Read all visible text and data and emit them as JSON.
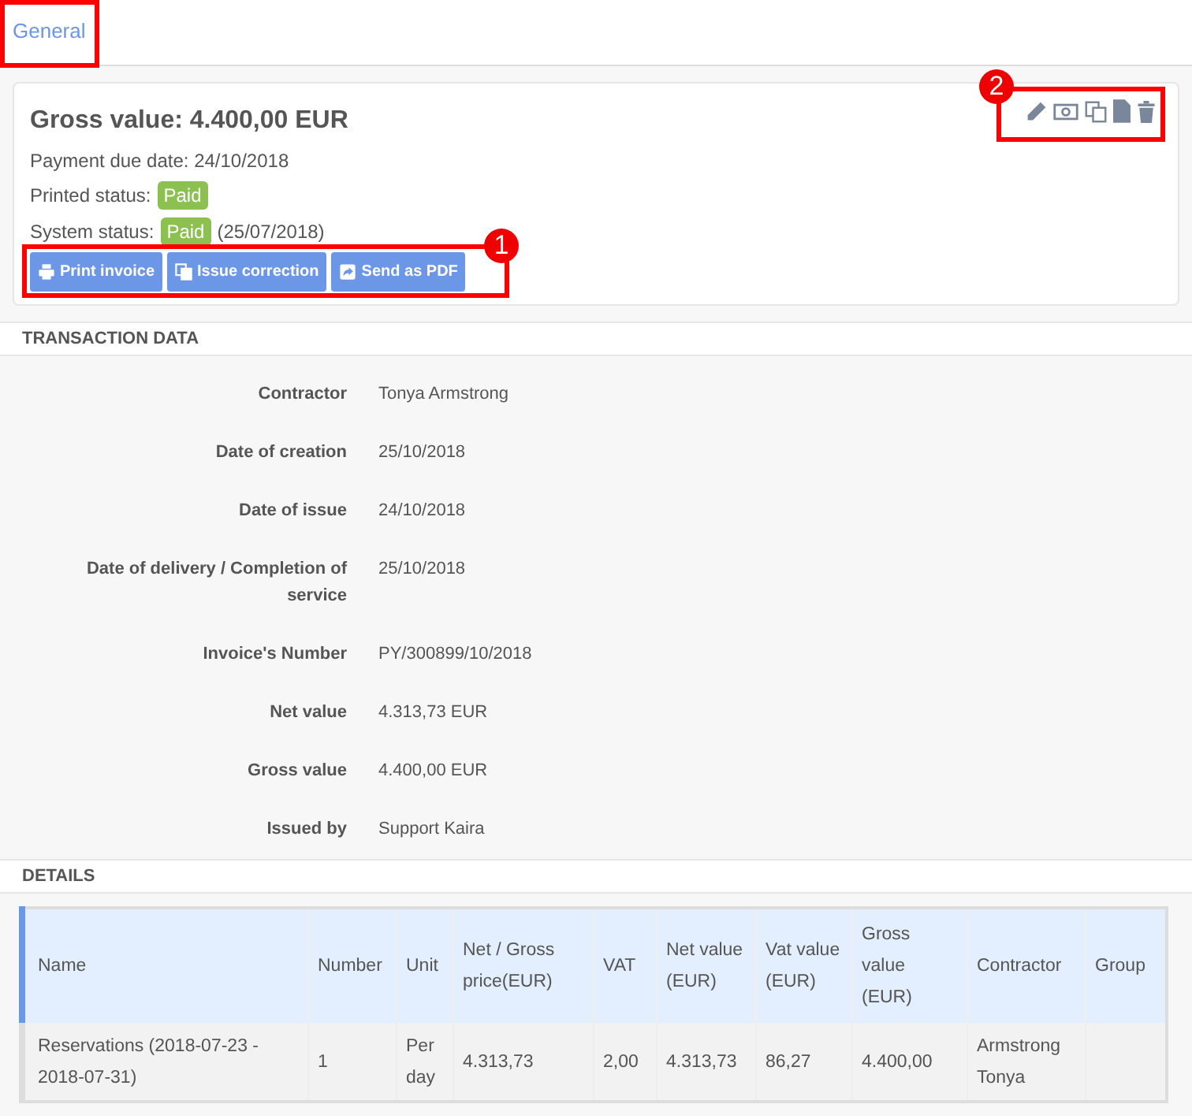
{
  "tabs": [
    {
      "label": "General",
      "selected": true
    }
  ],
  "summary": {
    "title": "Gross value: 4.400,00 EUR",
    "payment_due": "Payment due date: 24/10/2018",
    "printed_status_label": "Printed status:",
    "printed_status": {
      "label": "Paid",
      "color": "#8cc152"
    },
    "system_status_label": "System status:",
    "system_status": {
      "label": "Paid",
      "color": "#8cc152"
    },
    "system_status_date": "(25/07/2018)"
  },
  "buttons": [
    {
      "label": "Print invoice",
      "kind": "print"
    },
    {
      "label": "Issue correction",
      "kind": "copy"
    },
    {
      "label": "Send as PDF",
      "kind": "share"
    }
  ],
  "actions": [
    {
      "kind": "edit"
    },
    {
      "kind": "money"
    },
    {
      "kind": "copy"
    },
    {
      "kind": "file"
    },
    {
      "kind": "delete"
    }
  ],
  "annotations": [
    {
      "label": "1"
    },
    {
      "label": "2"
    }
  ],
  "transaction_data": {
    "title": "TRANSACTION DATA",
    "fields": [
      {
        "label": "Contractor",
        "value": "Tonya Armstrong"
      },
      {
        "label": "Date of creation",
        "value": "25/10/2018"
      },
      {
        "label": "Date of issue",
        "value": "24/10/2018"
      },
      {
        "label": "Date of delivery / Completion of service",
        "value": "25/10/2018"
      },
      {
        "label": "Invoice's Number",
        "value": "PY/300899/10/2018"
      },
      {
        "label": "Net value",
        "value": "4.313,73 EUR"
      },
      {
        "label": "Gross value",
        "value": "4.400,00 EUR"
      },
      {
        "label": "Issued by",
        "value": "Support Kaira"
      }
    ]
  },
  "details": {
    "title": "DETAILS",
    "columns": [
      "Name",
      "Number",
      "Unit",
      "Net / Gross price(EUR)",
      "VAT",
      "Net value (EUR)",
      "Vat value (EUR)",
      "Gross value (EUR)",
      "Contractor",
      "Group"
    ],
    "rows": [
      [
        "Reservations (2018-07-23 - 2018-07-31)",
        "1",
        "Per day",
        "4.313,73",
        "2,00",
        "4.313,73",
        "86,27",
        "4.400,00",
        "Armstrong Tonya",
        ""
      ]
    ]
  }
}
